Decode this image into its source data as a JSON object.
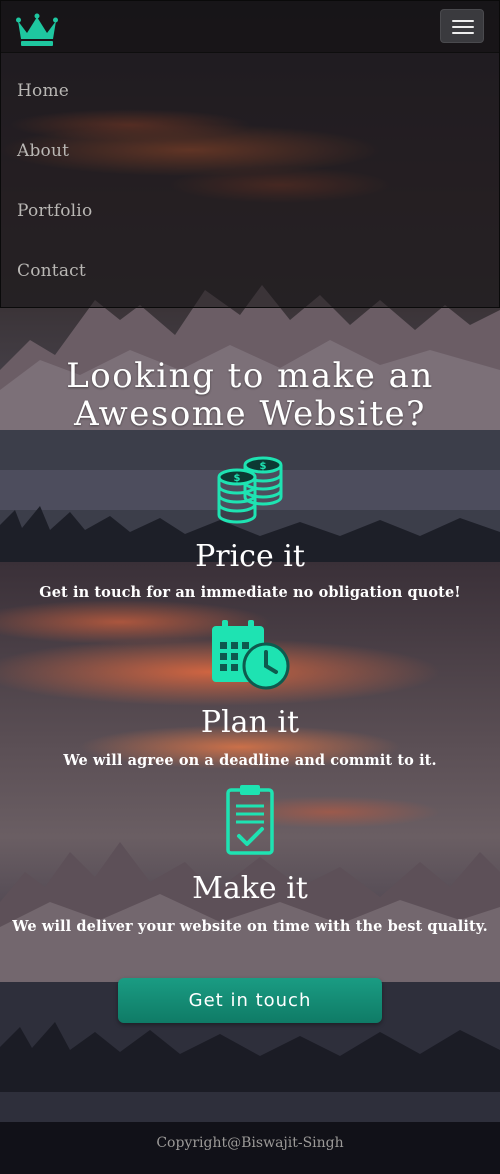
{
  "nav": {
    "links": [
      "Home",
      "About",
      "Portfolio",
      "Contact"
    ]
  },
  "hero": {
    "headline_line1": "Looking to make an",
    "headline_line2": "Awesome Website?"
  },
  "features": [
    {
      "icon": "coins-icon",
      "title": "Price it",
      "text": "Get in touch for an immediate no obligation quote!"
    },
    {
      "icon": "calendar-clock-icon",
      "title": "Plan it",
      "text": "We will agree on a deadline and commit to it."
    },
    {
      "icon": "clipboard-check-icon",
      "title": "Make it",
      "text": "We will deliver your website on time with the best quality."
    }
  ],
  "cta_label": "Get in touch",
  "footer_text": "Copyright@Biswajit-Singh",
  "colors": {
    "accent": "#1ee3b2",
    "button": "#128d75",
    "nav_text": "#b9b7b4"
  }
}
